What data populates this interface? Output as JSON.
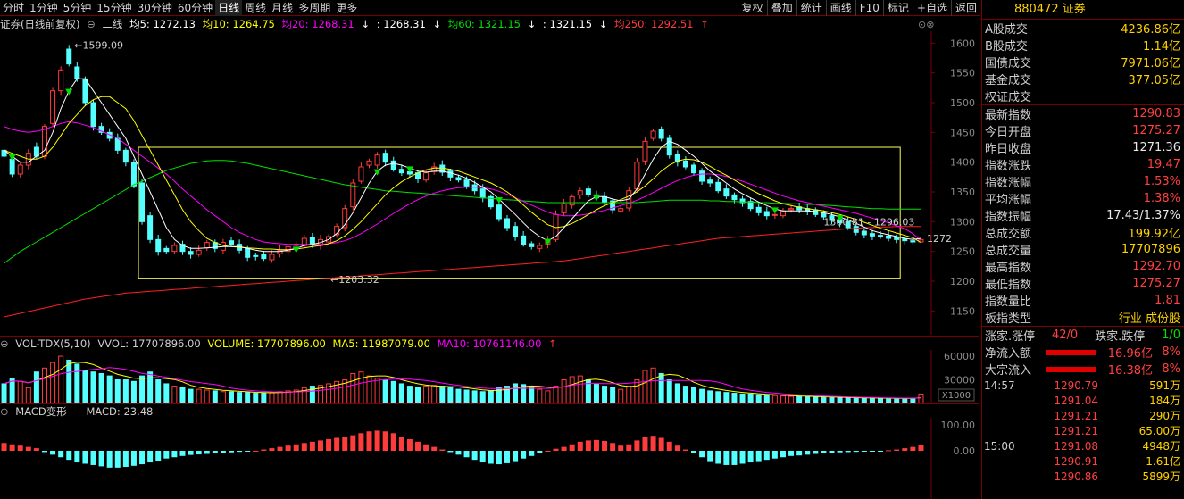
{
  "periods": [
    "分时",
    "1分钟",
    "5分钟",
    "15分钟",
    "30分钟",
    "60分钟",
    "日线",
    "周线",
    "月线",
    "多周期",
    "更多"
  ],
  "active_period": "日线",
  "toolbar_buttons": [
    "复权",
    "叠加",
    "统计",
    "画线",
    "F10",
    "标记",
    "+自选",
    "返回"
  ],
  "info_line": {
    "title": "证券(日线前复权)",
    "line_type": "二线",
    "ma5": "均5: 1272.13",
    "ma10": "均10: 1264.75",
    "ma20": "均20: 1268.31",
    "ma20b": ": 1268.31",
    "ma60": "均60: 1321.15",
    "ma60b": ": 1321.15",
    "ma250": "均250: 1292.51"
  },
  "main_axis": {
    "labels": [
      "1600",
      "1550",
      "1500",
      "1450",
      "1400",
      "1350",
      "1300",
      "1250",
      "1200",
      "1150"
    ],
    "min": 1110,
    "max": 1620
  },
  "annotations": {
    "high": "1599.09",
    "low": "1203.32",
    "range": "1300.81 - 1296.03",
    "last": "1272"
  },
  "vol_info": {
    "name": "VOL-TDX(5,10)",
    "vvol": "VVOL: 17707896.00",
    "volume": "VOLUME: 17707896.00",
    "ma5": "MA5: 11987079.00",
    "ma10": "MA10: 10761146.00"
  },
  "vol_axis": {
    "labels": [
      "60000",
      "30000"
    ],
    "unit": "X1000"
  },
  "macd_info": {
    "name": "MACD变形",
    "value": "MACD: 23.48"
  },
  "macd_axis": {
    "labels": [
      "100.00",
      "0.00"
    ]
  },
  "colors": {
    "up": "#ff3c3c",
    "down": "#54ffff",
    "ma5": "#ffffff",
    "ma10": "#ffff00",
    "ma20": "#ff00ff",
    "ma60": "#00e000",
    "ma250": "#ff2020",
    "box": "#ffff55"
  },
  "chart_data": {
    "type": "candlestick",
    "close": [
      1410,
      1380,
      1395,
      1415,
      1410,
      1460,
      1520,
      1555,
      1565,
      1540,
      1500,
      1460,
      1450,
      1440,
      1420,
      1400,
      1360,
      1300,
      1270,
      1250,
      1250,
      1260,
      1250,
      1245,
      1252,
      1265,
      1255,
      1265,
      1262,
      1252,
      1240,
      1242,
      1238,
      1245,
      1252,
      1258,
      1262,
      1272,
      1262,
      1270,
      1275,
      1292,
      1322,
      1365,
      1392,
      1402,
      1412,
      1400,
      1388,
      1382,
      1380,
      1372,
      1382,
      1392,
      1383,
      1375,
      1370,
      1360,
      1352,
      1340,
      1325,
      1305,
      1290,
      1275,
      1262,
      1258,
      1260,
      1270,
      1312,
      1330,
      1342,
      1352,
      1345,
      1340,
      1333,
      1320,
      1322,
      1352,
      1400,
      1435,
      1452,
      1440,
      1412,
      1400,
      1392,
      1382,
      1368,
      1365,
      1352,
      1343,
      1337,
      1332,
      1322,
      1315,
      1310,
      1312,
      1318,
      1322,
      1320,
      1318,
      1312,
      1308,
      1302,
      1298,
      1290,
      1282,
      1278,
      1276,
      1275,
      1272,
      1270,
      1268,
      1266,
      1270
    ],
    "open": [
      1420,
      1405,
      1380,
      1395,
      1425,
      1410,
      1465,
      1520,
      1590,
      1560,
      1540,
      1500,
      1460,
      1450,
      1440,
      1420,
      1400,
      1365,
      1310,
      1270,
      1255,
      1250,
      1262,
      1250,
      1245,
      1256,
      1265,
      1252,
      1268,
      1262,
      1255,
      1243,
      1245,
      1236,
      1246,
      1250,
      1260,
      1260,
      1274,
      1260,
      1266,
      1278,
      1290,
      1325,
      1368,
      1395,
      1395,
      1415,
      1402,
      1388,
      1384,
      1382,
      1370,
      1384,
      1395,
      1385,
      1374,
      1370,
      1362,
      1355,
      1342,
      1328,
      1305,
      1292,
      1276,
      1263,
      1255,
      1262,
      1270,
      1315,
      1328,
      1345,
      1355,
      1345,
      1342,
      1335,
      1318,
      1323,
      1355,
      1402,
      1440,
      1455,
      1440,
      1413,
      1402,
      1395,
      1385,
      1370,
      1366,
      1355,
      1345,
      1338,
      1334,
      1324,
      1317,
      1312,
      1310,
      1320,
      1325,
      1322,
      1320,
      1314,
      1310,
      1304,
      1300,
      1292,
      1284,
      1280,
      1277,
      1276,
      1274,
      1271,
      1268,
      1266
    ],
    "ma5": [
      1420,
      1410,
      1400,
      1400,
      1410,
      1420,
      1450,
      1490,
      1520,
      1540,
      1540,
      1520,
      1500,
      1480,
      1460,
      1440,
      1410,
      1380,
      1350,
      1320,
      1290,
      1270,
      1260,
      1255,
      1255,
      1256,
      1257,
      1258,
      1258,
      1258,
      1255,
      1252,
      1250,
      1250,
      1250,
      1252,
      1255,
      1260,
      1262,
      1265,
      1270,
      1280,
      1295,
      1315,
      1340,
      1365,
      1385,
      1395,
      1398,
      1395,
      1390,
      1385,
      1383,
      1385,
      1385,
      1382,
      1378,
      1373,
      1366,
      1358,
      1350,
      1338,
      1325,
      1312,
      1298,
      1285,
      1275,
      1268,
      1275,
      1290,
      1305,
      1320,
      1335,
      1342,
      1342,
      1338,
      1335,
      1338,
      1355,
      1380,
      1405,
      1425,
      1435,
      1430,
      1420,
      1410,
      1398,
      1385,
      1375,
      1365,
      1355,
      1347,
      1340,
      1333,
      1327,
      1321,
      1318,
      1318,
      1318,
      1318,
      1317,
      1315,
      1312,
      1308,
      1303,
      1297,
      1291,
      1285,
      1281,
      1278,
      1275,
      1272,
      1270,
      1272
    ],
    "ma10": [
      1420,
      1415,
      1410,
      1405,
      1405,
      1410,
      1425,
      1445,
      1465,
      1480,
      1495,
      1505,
      1510,
      1510,
      1500,
      1490,
      1470,
      1445,
      1420,
      1395,
      1370,
      1345,
      1320,
      1300,
      1285,
      1272,
      1265,
      1260,
      1258,
      1257,
      1256,
      1255,
      1254,
      1254,
      1253,
      1253,
      1254,
      1256,
      1258,
      1260,
      1263,
      1268,
      1276,
      1287,
      1300,
      1315,
      1330,
      1345,
      1357,
      1367,
      1375,
      1382,
      1387,
      1390,
      1390,
      1388,
      1385,
      1380,
      1375,
      1370,
      1365,
      1358,
      1350,
      1340,
      1328,
      1316,
      1305,
      1295,
      1290,
      1292,
      1297,
      1304,
      1312,
      1320,
      1327,
      1332,
      1337,
      1343,
      1350,
      1360,
      1372,
      1385,
      1395,
      1402,
      1405,
      1404,
      1400,
      1393,
      1385,
      1378,
      1370,
      1362,
      1354,
      1347,
      1341,
      1335,
      1330,
      1327,
      1324,
      1322,
      1320,
      1318,
      1315,
      1312,
      1308,
      1304,
      1299,
      1294,
      1289,
      1285,
      1281,
      1277,
      1273,
      1265
    ],
    "ma20": [
      1460,
      1455,
      1452,
      1450,
      1452,
      1455,
      1460,
      1465,
      1468,
      1466,
      1462,
      1458,
      1452,
      1446,
      1440,
      1430,
      1420,
      1410,
      1400,
      1390,
      1380,
      1368,
      1355,
      1343,
      1332,
      1320,
      1310,
      1300,
      1290,
      1282,
      1276,
      1270,
      1266,
      1264,
      1263,
      1262,
      1262,
      1262,
      1262,
      1262,
      1263,
      1265,
      1268,
      1273,
      1280,
      1288,
      1296,
      1305,
      1314,
      1322,
      1330,
      1337,
      1343,
      1348,
      1352,
      1355,
      1357,
      1358,
      1358,
      1357,
      1355,
      1351,
      1346,
      1340,
      1334,
      1328,
      1322,
      1316,
      1312,
      1310,
      1310,
      1311,
      1313,
      1316,
      1319,
      1323,
      1327,
      1331,
      1336,
      1342,
      1349,
      1356,
      1363,
      1369,
      1374,
      1378,
      1380,
      1380,
      1379,
      1376,
      1372,
      1368,
      1363,
      1358,
      1353,
      1348,
      1343,
      1339,
      1335,
      1332,
      1329,
      1326,
      1323,
      1320,
      1317,
      1314,
      1310,
      1306,
      1302,
      1298,
      1293,
      1288,
      1280,
      1268
    ],
    "ma60": [
      1230,
      1240,
      1250,
      1258,
      1266,
      1274,
      1282,
      1290,
      1298,
      1306,
      1314,
      1322,
      1330,
      1338,
      1346,
      1354,
      1362,
      1368,
      1374,
      1380,
      1386,
      1390,
      1394,
      1398,
      1400,
      1402,
      1403,
      1403,
      1402,
      1400,
      1398,
      1395,
      1392,
      1389,
      1386,
      1383,
      1380,
      1377,
      1374,
      1371,
      1368,
      1365,
      1362,
      1360,
      1358,
      1356,
      1354,
      1352,
      1351,
      1350,
      1349,
      1348,
      1347,
      1346,
      1345,
      1344,
      1343,
      1342,
      1341,
      1340,
      1339,
      1338,
      1337,
      1336,
      1335,
      1334,
      1333,
      1332,
      1332,
      1332,
      1332,
      1332,
      1332,
      1332,
      1332,
      1332,
      1332,
      1332,
      1332,
      1333,
      1334,
      1335,
      1336,
      1336,
      1336,
      1336,
      1336,
      1335,
      1335,
      1334,
      1334,
      1333,
      1333,
      1332,
      1332,
      1331,
      1331,
      1330,
      1330,
      1329,
      1329,
      1328,
      1327,
      1326,
      1325,
      1324,
      1323,
      1322,
      1322,
      1321,
      1321,
      1321,
      1321,
      1321
    ],
    "ma250": [
      1140,
      1143,
      1146,
      1149,
      1152,
      1155,
      1158,
      1161,
      1164,
      1167,
      1170,
      1172,
      1174,
      1176,
      1178,
      1180,
      1181,
      1182,
      1183,
      1184,
      1185,
      1186,
      1187,
      1188,
      1189,
      1190,
      1191,
      1192,
      1193,
      1194,
      1195,
      1196,
      1197,
      1198,
      1199,
      1200,
      1201,
      1202,
      1203,
      1204,
      1205,
      1206,
      1207,
      1208,
      1209,
      1210,
      1211,
      1212,
      1213,
      1214,
      1215,
      1216,
      1217,
      1218,
      1219,
      1220,
      1221,
      1222,
      1223,
      1224,
      1225,
      1226,
      1227,
      1228,
      1229,
      1230,
      1231,
      1232,
      1233,
      1234,
      1236,
      1238,
      1240,
      1242,
      1244,
      1246,
      1248,
      1250,
      1252,
      1254,
      1256,
      1258,
      1260,
      1262,
      1264,
      1266,
      1268,
      1270,
      1272,
      1273,
      1274,
      1275,
      1276,
      1277,
      1278,
      1279,
      1280,
      1281,
      1282,
      1283,
      1284,
      1285,
      1286,
      1287,
      1288,
      1289,
      1290,
      1290,
      1291,
      1291,
      1292,
      1292,
      1292,
      1292
    ],
    "volume": [
      25000,
      32000,
      28000,
      20000,
      40000,
      45000,
      52000,
      60000,
      55000,
      50000,
      42000,
      40000,
      38000,
      35000,
      30000,
      30000,
      28000,
      35000,
      40000,
      30000,
      25000,
      22000,
      20000,
      18000,
      18000,
      17000,
      16000,
      15000,
      15000,
      14000,
      14000,
      13000,
      13000,
      14000,
      15000,
      16000,
      17000,
      20000,
      22000,
      23000,
      25000,
      28000,
      30000,
      38000,
      40000,
      35000,
      32000,
      30000,
      28000,
      25000,
      22000,
      20000,
      22000,
      23000,
      22000,
      20000,
      18000,
      17000,
      16000,
      15000,
      16000,
      20000,
      22000,
      25000,
      24000,
      20000,
      18000,
      16000,
      22000,
      30000,
      34000,
      35000,
      30000,
      25000,
      22000,
      20000,
      18000,
      22000,
      30000,
      42000,
      45000,
      38000,
      30000,
      25000,
      22000,
      20000,
      18000,
      16000,
      15000,
      14000,
      13000,
      12000,
      12000,
      11000,
      10000,
      10000,
      9500,
      9000,
      9000,
      8500,
      8000,
      8000,
      7500,
      7500,
      7000,
      7000,
      6800,
      6600,
      6500,
      6400,
      6300,
      6200,
      6500,
      12000
    ],
    "macd": [
      30,
      25,
      20,
      15,
      10,
      -5,
      -15,
      -25,
      -35,
      -45,
      -50,
      -55,
      -60,
      -65,
      -65,
      -62,
      -58,
      -52,
      -45,
      -38,
      -30,
      -25,
      -20,
      -16,
      -14,
      -12,
      -10,
      -8,
      -6,
      -4,
      -2,
      0,
      5,
      10,
      15,
      20,
      25,
      30,
      35,
      40,
      45,
      50,
      55,
      60,
      68,
      75,
      78,
      75,
      68,
      55,
      45,
      35,
      25,
      15,
      5,
      -5,
      -15,
      -25,
      -35,
      -45,
      -50,
      -52,
      -48,
      -40,
      -30,
      -20,
      -10,
      0,
      8,
      15,
      25,
      35,
      40,
      42,
      38,
      30,
      20,
      25,
      40,
      55,
      58,
      50,
      35,
      20,
      5,
      -10,
      -25,
      -40,
      -50,
      -55,
      -55,
      -50,
      -45,
      -40,
      -35,
      -30,
      -25,
      -20,
      -18,
      -15,
      -12,
      -10,
      -8,
      -6,
      -5,
      -4,
      -3,
      -2,
      -1,
      2,
      5,
      10,
      15,
      22
    ]
  },
  "right_panel": {
    "title": "880472 证券",
    "stats": [
      {
        "k": "A股成交",
        "v": "4236.86亿",
        "c": "yellow"
      },
      {
        "k": "B股成交",
        "v": "1.14亿",
        "c": "yellow"
      },
      {
        "k": "国债成交",
        "v": "7971.06亿",
        "c": "yellow"
      },
      {
        "k": "基金成交",
        "v": "377.05亿",
        "c": "yellow"
      },
      {
        "k": "权证成交",
        "v": "",
        "c": "yellow"
      }
    ],
    "quotes": [
      {
        "k": "最新指数",
        "v": "1290.83",
        "c": "red"
      },
      {
        "k": "今日开盘",
        "v": "1275.27",
        "c": "red"
      },
      {
        "k": "昨日收盘",
        "v": "1271.36",
        "c": "white"
      },
      {
        "k": "指数涨跌",
        "v": "19.47",
        "c": "red"
      },
      {
        "k": "指数涨幅",
        "v": "1.53%",
        "c": "red"
      },
      {
        "k": "平均涨幅",
        "v": "1.38%",
        "c": "red"
      },
      {
        "k": "指数振幅",
        "v": "17.43/1.37%",
        "c": "white"
      },
      {
        "k": "总成交额",
        "v": "199.92亿",
        "c": "yellow"
      },
      {
        "k": "总成交量",
        "v": "17707896",
        "c": "yellow"
      },
      {
        "k": "最高指数",
        "v": "1292.70",
        "c": "red"
      },
      {
        "k": "最低指数",
        "v": "1275.27",
        "c": "red"
      },
      {
        "k": "指数量比",
        "v": "1.81",
        "c": "red"
      },
      {
        "k": "板指类型",
        "v": "行业 成份股",
        "c": "yellow"
      }
    ],
    "updown": {
      "up_label": "涨家.涨停",
      "up_value": "42/0",
      "down_label": "跌家.跌停",
      "down_value": "1/0"
    },
    "flows": [
      {
        "k": "净流入额",
        "amt": "16.96亿",
        "pct": "8%"
      },
      {
        "k": "大宗流入",
        "amt": "16.38亿",
        "pct": "8%"
      }
    ],
    "ticks": [
      {
        "t": "14:57",
        "p": "1290.79",
        "v": "591万"
      },
      {
        "t": "",
        "p": "1291.04",
        "v": "184万"
      },
      {
        "t": "",
        "p": "1291.21",
        "v": "290万"
      },
      {
        "t": "",
        "p": "1291.21",
        "v": "65.00万"
      },
      {
        "t": "15:00",
        "p": "1291.08",
        "v": "4948万"
      },
      {
        "t": "",
        "p": "1290.91",
        "v": "1.61亿"
      },
      {
        "t": "",
        "p": "1290.86",
        "v": "5899万"
      }
    ]
  }
}
